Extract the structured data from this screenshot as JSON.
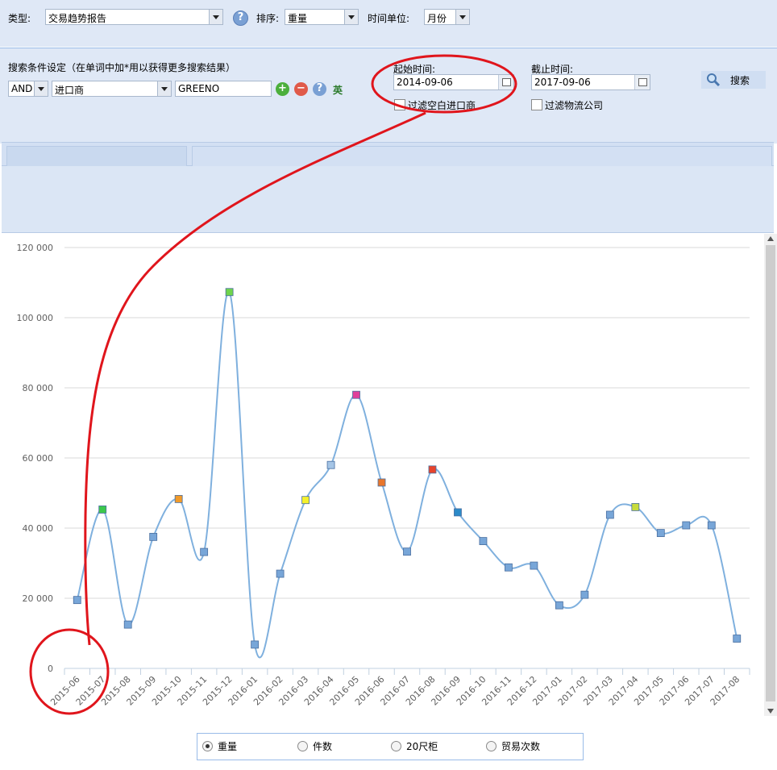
{
  "toolbar": {
    "type_label": "类型:",
    "type_value": "交易趋势报告",
    "sort_label": "排序:",
    "sort_value": "重量",
    "unit_label": "时间单位:",
    "unit_value": "月份"
  },
  "search": {
    "conditions_label": "搜索条件设定（在单词中加*用以获得更多搜索结果）",
    "logic_value": "AND",
    "field_value": "进口商",
    "keyword_value": "GREENO",
    "lang_label": "英",
    "start_label": "起始时间:",
    "start_value": "2014-09-06",
    "end_label": "截止时间:",
    "end_value": "2017-09-06",
    "filter_blank_label": "过滤空白进口商",
    "filter_logistics_label": "过滤物流公司",
    "search_button": "搜索"
  },
  "legend": {
    "options": [
      {
        "label": "重量",
        "selected": true
      },
      {
        "label": "件数",
        "selected": false
      },
      {
        "label": "20尺柜",
        "selected": false
      },
      {
        "label": "贸易次数",
        "selected": false
      }
    ]
  },
  "colors": {
    "line": "#7fb0de",
    "grid": "#d9d9d9",
    "annotation": "#e0151c"
  },
  "chart_data": {
    "type": "line",
    "categories": [
      "2015-06",
      "2015-07",
      "2015-08",
      "2015-09",
      "2015-10",
      "2015-11",
      "2015-12",
      "2016-01",
      "2016-02",
      "2016-03",
      "2016-04",
      "2016-05",
      "2016-06",
      "2016-07",
      "2016-08",
      "2016-09",
      "2016-10",
      "2016-11",
      "2016-12",
      "2017-01",
      "2017-02",
      "2017-03",
      "2017-04",
      "2017-05",
      "2017-06",
      "2017-07",
      "2017-08"
    ],
    "values": [
      19500,
      45300,
      12500,
      37500,
      48300,
      33200,
      107300,
      6800,
      27000,
      48000,
      58000,
      78000,
      53000,
      33300,
      56700,
      44500,
      36300,
      28800,
      29300,
      18000,
      21000,
      43800,
      46000,
      38600,
      40800,
      40800,
      8500
    ],
    "point_colors": [
      "#78a6d8",
      "#3cc84c",
      "#78a6d8",
      "#78a6d8",
      "#f19a2a",
      "#78a6d8",
      "#6fd44c",
      "#78a6d8",
      "#78a6d8",
      "#f4f02c",
      "#a5c5e6",
      "#e0409a",
      "#e8762c",
      "#78a6d8",
      "#e8442c",
      "#2c8ac8",
      "#78a6d8",
      "#78a6d8",
      "#78a6d8",
      "#78a6d8",
      "#78a6d8",
      "#78a6d8",
      "#c8dc3c",
      "#78a6d8",
      "#78a6d8",
      "#78a6d8",
      "#78a6d8"
    ],
    "yticks": [
      0,
      20000,
      40000,
      60000,
      80000,
      100000,
      120000
    ],
    "ytick_labels": [
      "0",
      "20 000",
      "40 000",
      "60 000",
      "80 000",
      "100 000",
      "120 000"
    ],
    "ylim": [
      0,
      120000
    ],
    "grid": true,
    "legend_position": "bottom"
  }
}
